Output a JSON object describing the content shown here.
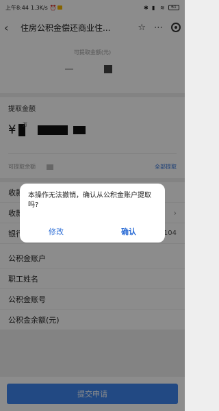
{
  "status_bar": {
    "time": "上午8:44",
    "speed": "1.3K/s",
    "battery": "61"
  },
  "navbar": {
    "title": "住房公积金偿还商业住..."
  },
  "balance_card": {
    "caption": "可提取金额(元)"
  },
  "withdraw": {
    "label": "提取金额",
    "currency": "¥",
    "unit": "万",
    "available_label": "可提取余额",
    "all_button": "全部提取"
  },
  "rows": [
    {
      "label": "收款"
    },
    {
      "label": "收款"
    },
    {
      "label": "银行卡号",
      "tail": "2104"
    },
    {
      "label": "公积金账户"
    },
    {
      "label": "职工姓名"
    },
    {
      "label": "公积金账号"
    },
    {
      "label": "公积金余额(元)"
    }
  ],
  "submit": {
    "label": "提交申请"
  },
  "dialog": {
    "message": "本操作无法撤销，确认从公积金账户提取吗?",
    "cancel_label": "修改",
    "confirm_label": "确认"
  },
  "colors": {
    "accent": "#2f6fd6",
    "button": "#3f86ee"
  }
}
